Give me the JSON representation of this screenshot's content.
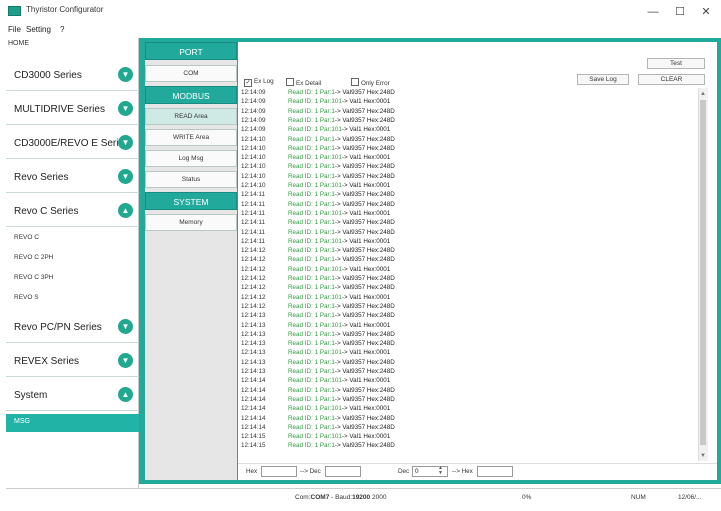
{
  "window": {
    "title": "Thyristor Configurator",
    "minimize": "—",
    "maximize": "☐",
    "close": "✕"
  },
  "menu": {
    "file": "File",
    "setting": "Setting",
    "help": "?"
  },
  "sidebar": {
    "home": "HOME",
    "series": [
      {
        "label": "CD3000 Series",
        "state": "collapsed"
      },
      {
        "label": "MULTIDRIVE Series",
        "state": "collapsed"
      },
      {
        "label": "CD3000E/REVO E Series",
        "state": "collapsed"
      },
      {
        "label": "Revo Series",
        "state": "collapsed"
      },
      {
        "label": "Revo C Series",
        "state": "expanded"
      },
      {
        "label": "Revo PC/PN Series",
        "state": "collapsed"
      },
      {
        "label": "REVEX Series",
        "state": "collapsed"
      },
      {
        "label": "System",
        "state": "expanded"
      }
    ],
    "revo_c_items": [
      "REVO C",
      "REVO C 2PH",
      "REVO C 3PH",
      "REVO S"
    ],
    "msg": "MSG"
  },
  "nav": {
    "port_header": "PORT",
    "com": "COM",
    "modbus_header": "MODBUS",
    "read_area": "READ Area",
    "write_area": "WRITE Area",
    "log_msg": "Log Msg",
    "status": "Status",
    "system_header": "SYSTEM",
    "memory": "Memory"
  },
  "toolbar": {
    "test": "Test",
    "save_log": "Save Log",
    "clear": "CLEAR"
  },
  "options": {
    "ex_log": "Ex Log",
    "ex_log_checked": true,
    "ex_detail": "Ex Detail",
    "only_error": "Only Error"
  },
  "log": [
    {
      "time": "12:14:09",
      "read": "Read ID: 1 Par:1",
      "val": "-> Val9357 Hex:248D"
    },
    {
      "time": "12:14:09",
      "read": "Read ID: 1 Par:101",
      "val": "-> Val1 Hex:0001"
    },
    {
      "time": "12:14:09",
      "read": "Read ID: 1 Par:1",
      "val": "-> Val9357 Hex:248D"
    },
    {
      "time": "12:14:09",
      "read": "Read ID: 1 Par:1",
      "val": "-> Val9357 Hex:248D"
    },
    {
      "time": "12:14:09",
      "read": "Read ID: 1 Par:101",
      "val": "-> Val1 Hex:0001"
    },
    {
      "time": "12:14:10",
      "read": "Read ID: 1 Par:1",
      "val": "-> Val9357 Hex:248D"
    },
    {
      "time": "12:14:10",
      "read": "Read ID: 1 Par:1",
      "val": "-> Val9357 Hex:248D"
    },
    {
      "time": "12:14:10",
      "read": "Read ID: 1 Par:101",
      "val": "-> Val1 Hex:0001"
    },
    {
      "time": "12:14:10",
      "read": "Read ID: 1 Par:1",
      "val": "-> Val9357 Hex:248D"
    },
    {
      "time": "12:14:10",
      "read": "Read ID: 1 Par:1",
      "val": "-> Val9357 Hex:248D"
    },
    {
      "time": "12:14:10",
      "read": "Read ID: 1 Par:101",
      "val": "-> Val1 Hex:0001"
    },
    {
      "time": "12:14:11",
      "read": "Read ID: 1 Par:1",
      "val": "-> Val9357 Hex:248D"
    },
    {
      "time": "12:14:11",
      "read": "Read ID: 1 Par:1",
      "val": "-> Val9357 Hex:248D"
    },
    {
      "time": "12:14:11",
      "read": "Read ID: 1 Par:101",
      "val": "-> Val1 Hex:0001"
    },
    {
      "time": "12:14:11",
      "read": "Read ID: 1 Par:1",
      "val": "-> Val9357 Hex:248D"
    },
    {
      "time": "12:14:11",
      "read": "Read ID: 1 Par:1",
      "val": "-> Val9357 Hex:248D"
    },
    {
      "time": "12:14:11",
      "read": "Read ID: 1 Par:101",
      "val": "-> Val1 Hex:0001"
    },
    {
      "time": "12:14:12",
      "read": "Read ID: 1 Par:1",
      "val": "-> Val9357 Hex:248D"
    },
    {
      "time": "12:14:12",
      "read": "Read ID: 1 Par:1",
      "val": "-> Val9357 Hex:248D"
    },
    {
      "time": "12:14:12",
      "read": "Read ID: 1 Par:101",
      "val": "-> Val1 Hex:0001"
    },
    {
      "time": "12:14:12",
      "read": "Read ID: 1 Par:1",
      "val": "-> Val9357 Hex:248D"
    },
    {
      "time": "12:14:12",
      "read": "Read ID: 1 Par:1",
      "val": "-> Val9357 Hex:248D"
    },
    {
      "time": "12:14:12",
      "read": "Read ID: 1 Par:101",
      "val": "-> Val1 Hex:0001"
    },
    {
      "time": "12:14:12",
      "read": "Read ID: 1 Par:1",
      "val": "-> Val9357 Hex:248D"
    },
    {
      "time": "12:14:13",
      "read": "Read ID: 1 Par:1",
      "val": "-> Val9357 Hex:248D"
    },
    {
      "time": "12:14:13",
      "read": "Read ID: 1 Par:101",
      "val": "-> Val1 Hex:0001"
    },
    {
      "time": "12:14:13",
      "read": "Read ID: 1 Par:1",
      "val": "-> Val9357 Hex:248D"
    },
    {
      "time": "12:14:13",
      "read": "Read ID: 1 Par:1",
      "val": "-> Val9357 Hex:248D"
    },
    {
      "time": "12:14:13",
      "read": "Read ID: 1 Par:101",
      "val": "-> Val1 Hex:0001"
    },
    {
      "time": "12:14:13",
      "read": "Read ID: 1 Par:1",
      "val": "-> Val9357 Hex:248D"
    },
    {
      "time": "12:14:13",
      "read": "Read ID: 1 Par:1",
      "val": "-> Val9357 Hex:248D"
    },
    {
      "time": "12:14:14",
      "read": "Read ID: 1 Par:101",
      "val": "-> Val1 Hex:0001"
    },
    {
      "time": "12:14:14",
      "read": "Read ID: 1 Par:1",
      "val": "-> Val9357 Hex:248D"
    },
    {
      "time": "12:14:14",
      "read": "Read ID: 1 Par:1",
      "val": "-> Val9357 Hex:248D"
    },
    {
      "time": "12:14:14",
      "read": "Read ID: 1 Par:101",
      "val": "-> Val1 Hex:0001"
    },
    {
      "time": "12:14:14",
      "read": "Read ID: 1 Par:1",
      "val": "-> Val9357 Hex:248D"
    },
    {
      "time": "12:14:14",
      "read": "Read ID: 1 Par:1",
      "val": "-> Val9357 Hex:248D"
    },
    {
      "time": "12:14:15",
      "read": "Read ID: 1 Par:101",
      "val": "-> Val1 Hex:0001"
    },
    {
      "time": "12:14:15",
      "read": "Read ID: 1 Par:1",
      "val": "-> Val9357 Hex:248D"
    }
  ],
  "converter": {
    "hex_label": "Hex",
    "to_dec": "--> Dec",
    "dec_label": "Dec",
    "dec_value": "0",
    "to_hex": "--> Hex"
  },
  "statusbar": {
    "com_prefix": "Com:",
    "com_port": "COM7",
    "baud_prefix": " - Baud:",
    "baud": "19200",
    "extra": "2000",
    "percent": "0%",
    "num": "NUM",
    "date": "12/06/..."
  },
  "colors": {
    "accent": "#21a99c",
    "log_green": "#2e9a3e"
  }
}
